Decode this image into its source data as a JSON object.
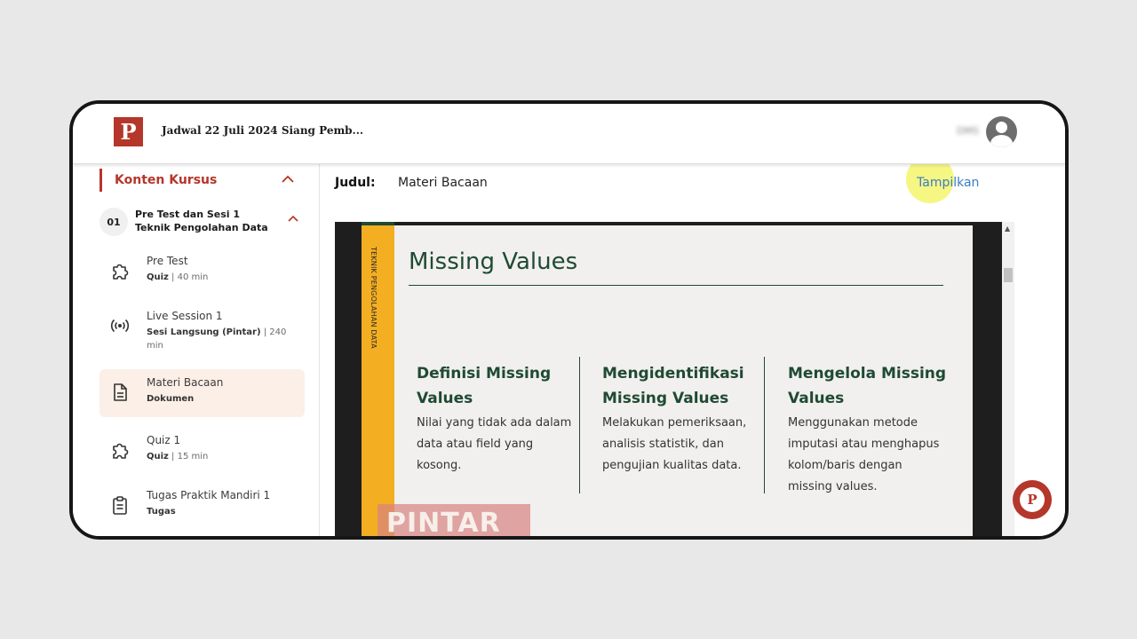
{
  "header": {
    "logo_letter": "P",
    "title": "Jadwal 22 Juli 2024 Siang Pemb...",
    "user_name": "DMS"
  },
  "sidebar": {
    "section_title": "Konten Kursus",
    "session": {
      "number": "01",
      "title": "Pre Test dan Sesi 1 Teknik Pengolahan Data"
    },
    "items": [
      {
        "name": "Pre Test",
        "type": "Quiz",
        "detail": " | 40 min",
        "icon": "puzzle-icon"
      },
      {
        "name": "Live Session 1",
        "type": "Sesi Langsung (Pintar)",
        "detail": " | 240 min",
        "icon": "broadcast-icon"
      },
      {
        "name": "Materi Bacaan",
        "type": "Dokumen",
        "detail": "",
        "icon": "document-icon"
      },
      {
        "name": "Quiz 1",
        "type": "Quiz",
        "detail": " | 15 min",
        "icon": "puzzle-icon"
      },
      {
        "name": "Tugas Praktik Mandiri 1",
        "type": "Tugas",
        "detail": "",
        "icon": "clipboard-icon"
      }
    ]
  },
  "main": {
    "judul_label": "Judul:",
    "judul_value": "Materi Bacaan",
    "show_link": "Tampilkan"
  },
  "slide": {
    "side_label": "TEKNIK PENGOLAHAN DATA",
    "title": "Missing Values",
    "columns": [
      {
        "heading": "Definisi Missing Values",
        "body": "Nilai yang tidak ada dalam data atau field yang kosong."
      },
      {
        "heading": "Mengidentifikasi Missing Values",
        "body": "Melakukan pemeriksaan, analisis statistik, dan pengujian kualitas data."
      },
      {
        "heading": "Mengelola Missing Values",
        "body": "Menggunakan metode imputasi atau menghapus kolom/baris dengan missing values."
      }
    ],
    "watermark": "PINTAR"
  },
  "chat": {
    "letter": "P"
  },
  "colors": {
    "brand": "#b5362a",
    "active_bg": "#fbefe8",
    "slide_green": "#1f4a33",
    "slide_yellow": "#f3ae22",
    "link": "#3a7cc5"
  }
}
